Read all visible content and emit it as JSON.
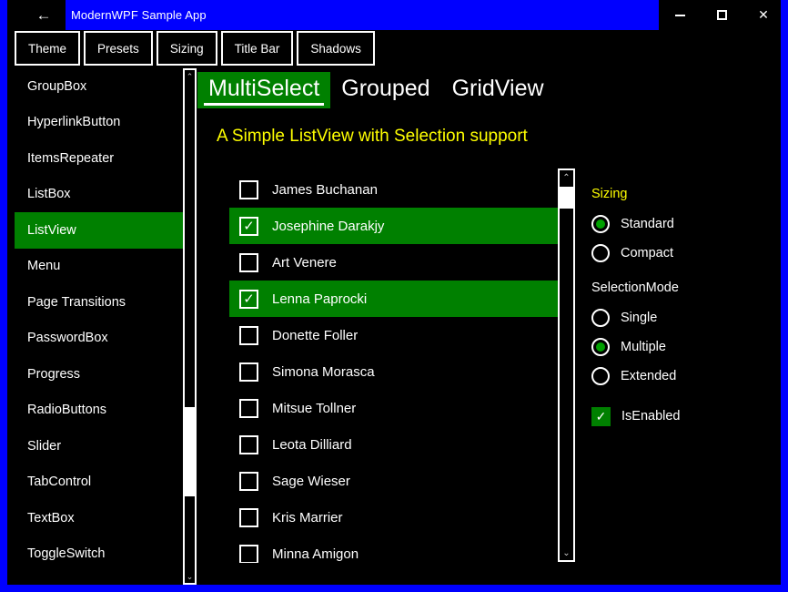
{
  "window": {
    "title": "ModernWPF Sample App",
    "back_icon": "←",
    "controls": {
      "minimize": "minimize-icon",
      "maximize": "maximize-icon",
      "close": "✕"
    },
    "accent_blue": "#0000ff",
    "accent_green": "#008000"
  },
  "topbar": {
    "buttons": [
      {
        "label": "Theme"
      },
      {
        "label": "Presets"
      },
      {
        "label": "Sizing"
      },
      {
        "label": "Title Bar"
      },
      {
        "label": "Shadows"
      }
    ]
  },
  "sidebar": {
    "items": [
      {
        "label": "GroupBox",
        "selected": false
      },
      {
        "label": "HyperlinkButton",
        "selected": false
      },
      {
        "label": "ItemsRepeater",
        "selected": false
      },
      {
        "label": "ListBox",
        "selected": false
      },
      {
        "label": "ListView",
        "selected": true
      },
      {
        "label": "Menu",
        "selected": false
      },
      {
        "label": "Page Transitions",
        "selected": false
      },
      {
        "label": "PasswordBox",
        "selected": false
      },
      {
        "label": "Progress",
        "selected": false
      },
      {
        "label": "RadioButtons",
        "selected": false
      },
      {
        "label": "Slider",
        "selected": false
      },
      {
        "label": "TabControl",
        "selected": false
      },
      {
        "label": "TextBox",
        "selected": false
      },
      {
        "label": "ToggleSwitch",
        "selected": false
      }
    ],
    "scrollbar": {
      "up_arrow": "⌃",
      "down_arrow": "⌄"
    }
  },
  "content": {
    "tabs": [
      {
        "label": "MultiSelect",
        "active": true
      },
      {
        "label": "Grouped",
        "active": false
      },
      {
        "label": "GridView",
        "active": false
      }
    ],
    "subtitle": "A Simple ListView with Selection support",
    "list": {
      "check_glyph": "✓",
      "items": [
        {
          "name": "James Buchanan",
          "checked": false
        },
        {
          "name": "Josephine Darakjy",
          "checked": true
        },
        {
          "name": "Art Venere",
          "checked": false
        },
        {
          "name": "Lenna Paprocki",
          "checked": true
        },
        {
          "name": "Donette Foller",
          "checked": false
        },
        {
          "name": "Simona Morasca",
          "checked": false
        },
        {
          "name": "Mitsue Tollner",
          "checked": false
        },
        {
          "name": "Leota Dilliard",
          "checked": false
        },
        {
          "name": "Sage Wieser",
          "checked": false
        },
        {
          "name": "Kris Marrier",
          "checked": false
        },
        {
          "name": "Minna Amigon",
          "checked": false
        }
      ],
      "scrollbar": {
        "up_arrow": "⌃",
        "down_arrow": "⌄"
      }
    },
    "options": {
      "sizing_header": "Sizing",
      "sizing_options": [
        {
          "label": "Standard",
          "selected": true
        },
        {
          "label": "Compact",
          "selected": false
        }
      ],
      "selectionmode_header": "SelectionMode",
      "selectionmode_options": [
        {
          "label": "Single",
          "selected": false
        },
        {
          "label": "Multiple",
          "selected": true
        },
        {
          "label": "Extended",
          "selected": false
        }
      ],
      "isenabled": {
        "label": "IsEnabled",
        "checked": true,
        "glyph": "✓"
      }
    }
  }
}
